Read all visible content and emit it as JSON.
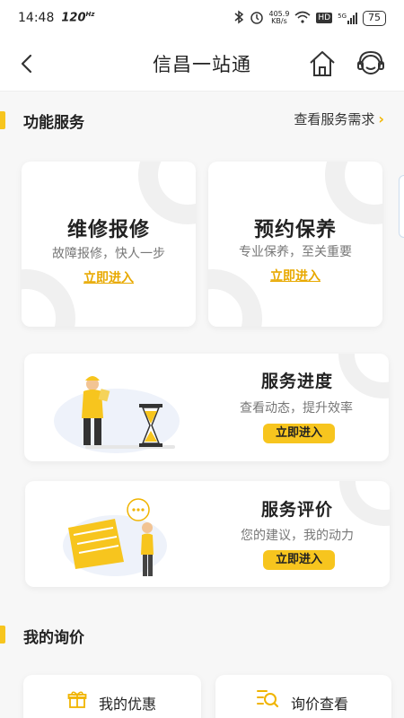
{
  "status_bar": {
    "time": "14:48",
    "refresh_rate": "120",
    "refresh_unit": "Hz",
    "net_speed_value": "405.9",
    "net_speed_unit": "KB/s",
    "hd_label": "HD",
    "network_label": "5G",
    "battery": "75"
  },
  "header": {
    "title": "信昌一站通",
    "back_icon": "back-arrow-icon",
    "home_icon": "home-icon",
    "service_icon": "customer-service-icon"
  },
  "functions": {
    "section_title": "功能服务",
    "link_label": "查看服务需求",
    "cards": [
      {
        "title": "维修报修",
        "subtitle": "故障报修，快人一步",
        "action": "立即进入"
      },
      {
        "title": "预约保养",
        "subtitle": "专业保养，至关重要",
        "action": "立即进入"
      },
      {
        "title": "服务进度",
        "subtitle": "查看动态，提升效率",
        "action": "立即进入"
      },
      {
        "title": "服务评价",
        "subtitle": "您的建议，我的动力",
        "action": "立即进入"
      }
    ]
  },
  "inquiry": {
    "section_title": "我的询价",
    "items": [
      {
        "label": "我的优惠",
        "icon": "gift-icon"
      },
      {
        "label": "询价查看",
        "icon": "search-list-icon"
      }
    ]
  },
  "colors": {
    "accent": "#f7c51e",
    "link": "#e8a900",
    "background": "#f7f7f7"
  }
}
